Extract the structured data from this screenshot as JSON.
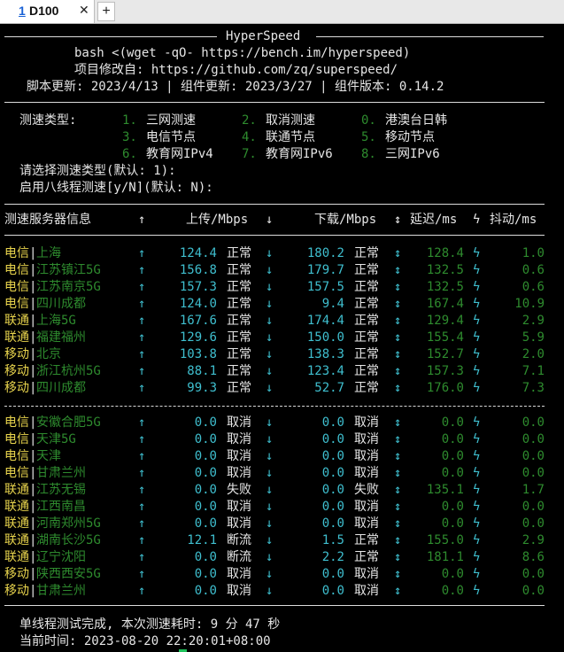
{
  "tab": {
    "number": "1",
    "title": "D100",
    "close": "✕",
    "new": "+"
  },
  "header": {
    "title": "HyperSpeed",
    "line1": "bash <(wget -qO- https://bench.im/hyperspeed)",
    "line2": "项目修改自: https://github.com/zq/superspeed/",
    "line3": "脚本更新: 2023/4/13 | 组件更新: 2023/3/27 | 组件版本: 0.14.2"
  },
  "menu": {
    "label": "测速类型:",
    "options": [
      {
        "num": "1.",
        "text": "三网测速"
      },
      {
        "num": "2.",
        "text": "取消测速"
      },
      {
        "num": "0.",
        "text": "港澳台日韩"
      },
      {
        "num": "3.",
        "text": "电信节点"
      },
      {
        "num": "4.",
        "text": "联通节点"
      },
      {
        "num": "5.",
        "text": "移动节点"
      },
      {
        "num": "6.",
        "text": "教育网IPv4"
      },
      {
        "num": "7.",
        "text": "教育网IPv6"
      },
      {
        "num": "8.",
        "text": "三网IPv6"
      }
    ],
    "prompt1": "请选择测速类型(默认: 1):",
    "prompt2": "启用八线程测速[y/N](默认: N):"
  },
  "table_header": {
    "server": "测速服务器信息",
    "up_arrow": "↑",
    "upload": "上传/Mbps",
    "down_arrow": "↓",
    "download": "下载/Mbps",
    "updown": "↕",
    "latency": "延迟/ms",
    "jitter_sym": "ϟ",
    "jitter": "抖动/ms"
  },
  "sep": "|",
  "group1": [
    {
      "isp": "电信",
      "loc": "上海",
      "up": "124.4",
      "up_status": "正常",
      "down": "180.2",
      "down_status": "正常",
      "latency": "128.4",
      "jitter": "1.0"
    },
    {
      "isp": "电信",
      "loc": "江苏镇江5G",
      "up": "156.8",
      "up_status": "正常",
      "down": "179.7",
      "down_status": "正常",
      "latency": "132.5",
      "jitter": "0.6"
    },
    {
      "isp": "电信",
      "loc": "江苏南京5G",
      "up": "157.3",
      "up_status": "正常",
      "down": "157.5",
      "down_status": "正常",
      "latency": "132.5",
      "jitter": "0.6"
    },
    {
      "isp": "电信",
      "loc": "四川成都",
      "up": "124.0",
      "up_status": "正常",
      "down": "9.4",
      "down_status": "正常",
      "latency": "167.4",
      "jitter": "10.9"
    },
    {
      "isp": "联通",
      "loc": "上海5G",
      "up": "167.6",
      "up_status": "正常",
      "down": "174.4",
      "down_status": "正常",
      "latency": "129.4",
      "jitter": "2.9"
    },
    {
      "isp": "联通",
      "loc": "福建福州",
      "up": "129.6",
      "up_status": "正常",
      "down": "150.0",
      "down_status": "正常",
      "latency": "155.4",
      "jitter": "5.9"
    },
    {
      "isp": "移动",
      "loc": "北京",
      "up": "103.8",
      "up_status": "正常",
      "down": "138.3",
      "down_status": "正常",
      "latency": "152.7",
      "jitter": "2.0"
    },
    {
      "isp": "移动",
      "loc": "浙江杭州5G",
      "up": "88.1",
      "up_status": "正常",
      "down": "123.4",
      "down_status": "正常",
      "latency": "157.3",
      "jitter": "7.1"
    },
    {
      "isp": "移动",
      "loc": "四川成都",
      "up": "99.3",
      "up_status": "正常",
      "down": "52.7",
      "down_status": "正常",
      "latency": "176.0",
      "jitter": "7.3"
    }
  ],
  "group2": [
    {
      "isp": "电信",
      "loc": "安徽合肥5G",
      "up": "0.0",
      "up_status": "取消",
      "down": "0.0",
      "down_status": "取消",
      "latency": "0.0",
      "jitter": "0.0"
    },
    {
      "isp": "电信",
      "loc": "天津5G",
      "up": "0.0",
      "up_status": "取消",
      "down": "0.0",
      "down_status": "取消",
      "latency": "0.0",
      "jitter": "0.0"
    },
    {
      "isp": "电信",
      "loc": "天津",
      "up": "0.0",
      "up_status": "取消",
      "down": "0.0",
      "down_status": "取消",
      "latency": "0.0",
      "jitter": "0.0"
    },
    {
      "isp": "电信",
      "loc": "甘肃兰州",
      "up": "0.0",
      "up_status": "取消",
      "down": "0.0",
      "down_status": "取消",
      "latency": "0.0",
      "jitter": "0.0"
    },
    {
      "isp": "联通",
      "loc": "江苏无锡",
      "up": "0.0",
      "up_status": "失败",
      "down": "0.0",
      "down_status": "失败",
      "latency": "135.1",
      "jitter": "1.7"
    },
    {
      "isp": "联通",
      "loc": "江西南昌",
      "up": "0.0",
      "up_status": "取消",
      "down": "0.0",
      "down_status": "取消",
      "latency": "0.0",
      "jitter": "0.0"
    },
    {
      "isp": "联通",
      "loc": "河南郑州5G",
      "up": "0.0",
      "up_status": "取消",
      "down": "0.0",
      "down_status": "取消",
      "latency": "0.0",
      "jitter": "0.0"
    },
    {
      "isp": "联通",
      "loc": "湖南长沙5G",
      "up": "12.1",
      "up_status": "断流",
      "down": "1.5",
      "down_status": "正常",
      "latency": "155.0",
      "jitter": "2.9"
    },
    {
      "isp": "联通",
      "loc": "辽宁沈阳",
      "up": "0.0",
      "up_status": "断流",
      "down": "2.2",
      "down_status": "正常",
      "latency": "181.1",
      "jitter": "8.6"
    },
    {
      "isp": "移动",
      "loc": "陕西西安5G",
      "up": "0.0",
      "up_status": "取消",
      "down": "0.0",
      "down_status": "取消",
      "latency": "0.0",
      "jitter": "0.0"
    },
    {
      "isp": "移动",
      "loc": "甘肃兰州",
      "up": "0.0",
      "up_status": "取消",
      "down": "0.0",
      "down_status": "取消",
      "latency": "0.0",
      "jitter": "0.0"
    }
  ],
  "footer": {
    "done": "单线程测试完成, 本次测速耗时: 9 分 47 秒",
    "time": "当前时间: 2023-08-20 22:20:01+08:00"
  }
}
